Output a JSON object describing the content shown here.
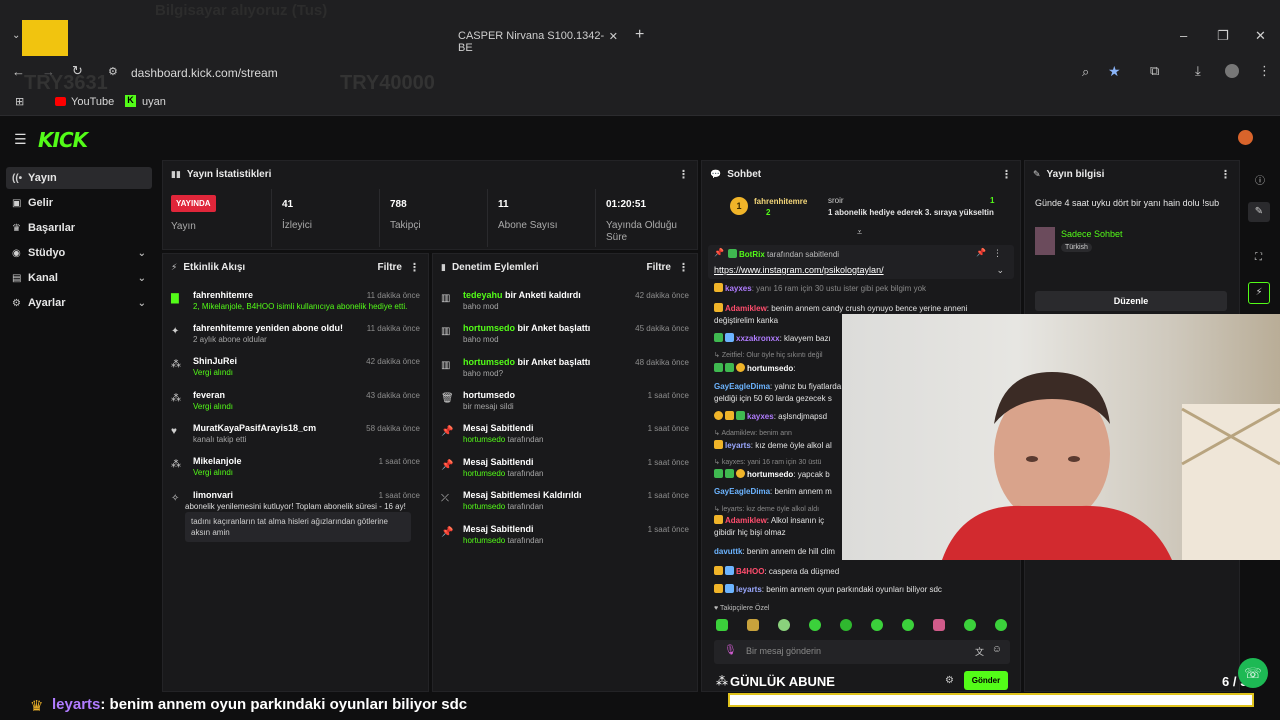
{
  "browser": {
    "tab_title": "CASPER Nirvana S100.1342-BE",
    "url": "dashboard.kick.com/stream",
    "bookmarks": [
      "YouTube",
      "uyan"
    ],
    "ghost_texts": [
      "Bilgisayar alıyoruz (Tus)",
      "TRY3631",
      "TRY40000"
    ]
  },
  "sidebar": {
    "items": [
      {
        "label": "Yayın",
        "icon": "broadcast-icon",
        "active": true
      },
      {
        "label": "Gelir",
        "icon": "money-icon"
      },
      {
        "label": "Başarılar",
        "icon": "trophy-icon"
      },
      {
        "label": "Stüdyo",
        "icon": "studio-icon",
        "expandable": true
      },
      {
        "label": "Kanal",
        "icon": "channel-icon",
        "expandable": true
      },
      {
        "label": "Ayarlar",
        "icon": "settings-icon",
        "expandable": true
      }
    ]
  },
  "stats": {
    "title": "Yayın İstatistikleri",
    "live_badge": "YAYINDA",
    "live_label": "Yayın",
    "items": [
      {
        "value": "41",
        "label": "İzleyici"
      },
      {
        "value": "788",
        "label": "Takipçi"
      },
      {
        "value": "11",
        "label": "Abone Sayısı"
      },
      {
        "value": "01:20:51",
        "label": "Yayında Olduğu Süre"
      }
    ]
  },
  "activity": {
    "title": "Etkinlik Akışı",
    "filter": "Filtre",
    "rows": [
      {
        "title": "fahrenhitemre",
        "sub": "2, Mikelanjole, B4HOO isimli kullanıcıya abonelik hediye etti.",
        "time": "11 dakika önce"
      },
      {
        "title": "fahrenhitemre yeniden abone oldu!",
        "sub": "2 aylık abone oldular",
        "time": "11 dakika önce"
      },
      {
        "title": "ShinJuRei",
        "sub": "Vergi alındı",
        "time": "42 dakika önce"
      },
      {
        "title": "feveran",
        "sub": "Vergi alındı",
        "time": "43 dakika önce"
      },
      {
        "title": "MuratKayaPasifArayis18_cm",
        "sub": "kanalı takip etti",
        "time": "58 dakika önce"
      },
      {
        "title": "Mikelanjole",
        "sub": "Vergi alındı",
        "time": "1 saat önce"
      },
      {
        "title": "limonvari",
        "sub": "abonelik yenilemesini kutluyor! Toplam abonelik süresi - 16 ay!",
        "time": "1 saat önce",
        "message": "tadını kaçıranların tat alma hisleri ağızlarından götlerine aksın amin"
      }
    ]
  },
  "moderation": {
    "title": "Denetim Eylemleri",
    "filter": "Filtre",
    "rows": [
      {
        "title": "tedeyahu bir Anketi kaldırdı",
        "sub": "baho mod",
        "time": "42 dakika önce"
      },
      {
        "title": "hortumsedo bir Anket başlattı",
        "sub": "baho mod",
        "time": "45 dakika önce"
      },
      {
        "title": "hortumsedo bir Anket başlattı",
        "sub": "baho mod?",
        "time": "48 dakika önce"
      },
      {
        "title": "hortumsedo",
        "sub": "bir mesajı sildi",
        "time": "1 saat önce"
      },
      {
        "title": "Mesaj Sabitlendi",
        "sub": "hortumsedo tarafından",
        "time": "1 saat önce"
      },
      {
        "title": "Mesaj Sabitlendi",
        "sub": "hortumsedo tarafından",
        "time": "1 saat önce"
      },
      {
        "title": "Mesaj Sabitlemesi Kaldırıldı",
        "sub": "hortumsedo tarafından",
        "time": "1 saat önce"
      },
      {
        "title": "Mesaj Sabitlendi",
        "sub": "hortumsedo tarafından",
        "time": "1 saat önce"
      }
    ]
  },
  "chat": {
    "title": "Sohbet",
    "gift_user": "fahrenhitemre",
    "gift_count": "2",
    "gift_right_user": "sroir",
    "gift_right_count": "1",
    "gift_text": "1 abonelik hediye ederek 3. sıraya yükseltin",
    "pinned_by": "BotRix tarafından sabitlendi",
    "pinned_link": "https://www.instagram.com/psikologtaylan/",
    "messages": [
      {
        "user": "kayxes",
        "text": "yanı 16 ram için 30 ustu ister gibi pek bilgim yok",
        "color": "#b07cff"
      },
      {
        "user": "Adamiklew",
        "text": "benim annem candy crush oynuyo bence      yerine anneni değiştirelim kanka",
        "color": "#ff4d6d"
      },
      {
        "user": "xxzakronxx",
        "text": "klavyem bazı",
        "color": "#b07cff"
      },
      {
        "user": "Zeitfiel",
        "text": "Olur öyle hiç sıkıntı değil",
        "color": "#888"
      },
      {
        "user": "hortumsedo",
        "text": "",
        "color": "#ffffff"
      },
      {
        "user": "GayEagleDima",
        "text": "yalnız bu fiyatlarda geldiği için 50 60 larda gezecek s",
        "color": "#6cb4ff"
      },
      {
        "user": "kayxes",
        "text": "aşlsndjmapsd",
        "color": "#b07cff"
      },
      {
        "user": "Adamiklew",
        "text": "benim ann",
        "color": "#888"
      },
      {
        "user": "leyarts",
        "text": "kız deme öyle alkol al",
        "color": "#9aa8ff"
      },
      {
        "user": "kayxes",
        "text": "yani 16 ram için 30 üstü",
        "color": "#888"
      },
      {
        "user": "hortumsedo",
        "text": "yapcak b",
        "color": "#ffffff"
      },
      {
        "user": "GayEagleDima",
        "text": "benim annem m",
        "color": "#6cb4ff"
      },
      {
        "user": "leyarts",
        "text": "kız deme öyle alkol aldı",
        "color": "#888"
      },
      {
        "user": "Adamiklew",
        "text": "Alkol insanın iç gibidir hiç bişi olmaz",
        "color": "#ff4d6d"
      },
      {
        "user": "davuttk",
        "text": "benim annem de hill clim",
        "color": "#6cb4ff"
      },
      {
        "user": "B4HOO",
        "text": "caspera da düşmed",
        "color": "#ff4d6d"
      },
      {
        "user": "leyarts",
        "text": "benim annem oyun parkındaki oyunları biliyor sdc",
        "color": "#9aa8ff"
      }
    ],
    "followers_only": "Takipçilere Özel",
    "input_placeholder": "Bir mesaj gönderin",
    "send": "Gönder"
  },
  "info": {
    "title": "Yayın bilgisi",
    "stream_title": "Günde 4 saat uyku dört bir yanı hain dolu !sub",
    "category": "Sadece Sohbet",
    "language": "Türkish",
    "edit": "Düzenle"
  },
  "overlay": {
    "goal_label": "GÜNLÜK ABUNE",
    "goal_count": "6 / 5",
    "goal_progress": 1.0,
    "ticker_user": "leyarts",
    "ticker_text": ": benim annem oyun parkındaki oyunları biliyor sdc"
  },
  "colors": {
    "kick_green": "#53fc18",
    "live_red": "#e0263a",
    "panel_bg": "#19191b"
  }
}
